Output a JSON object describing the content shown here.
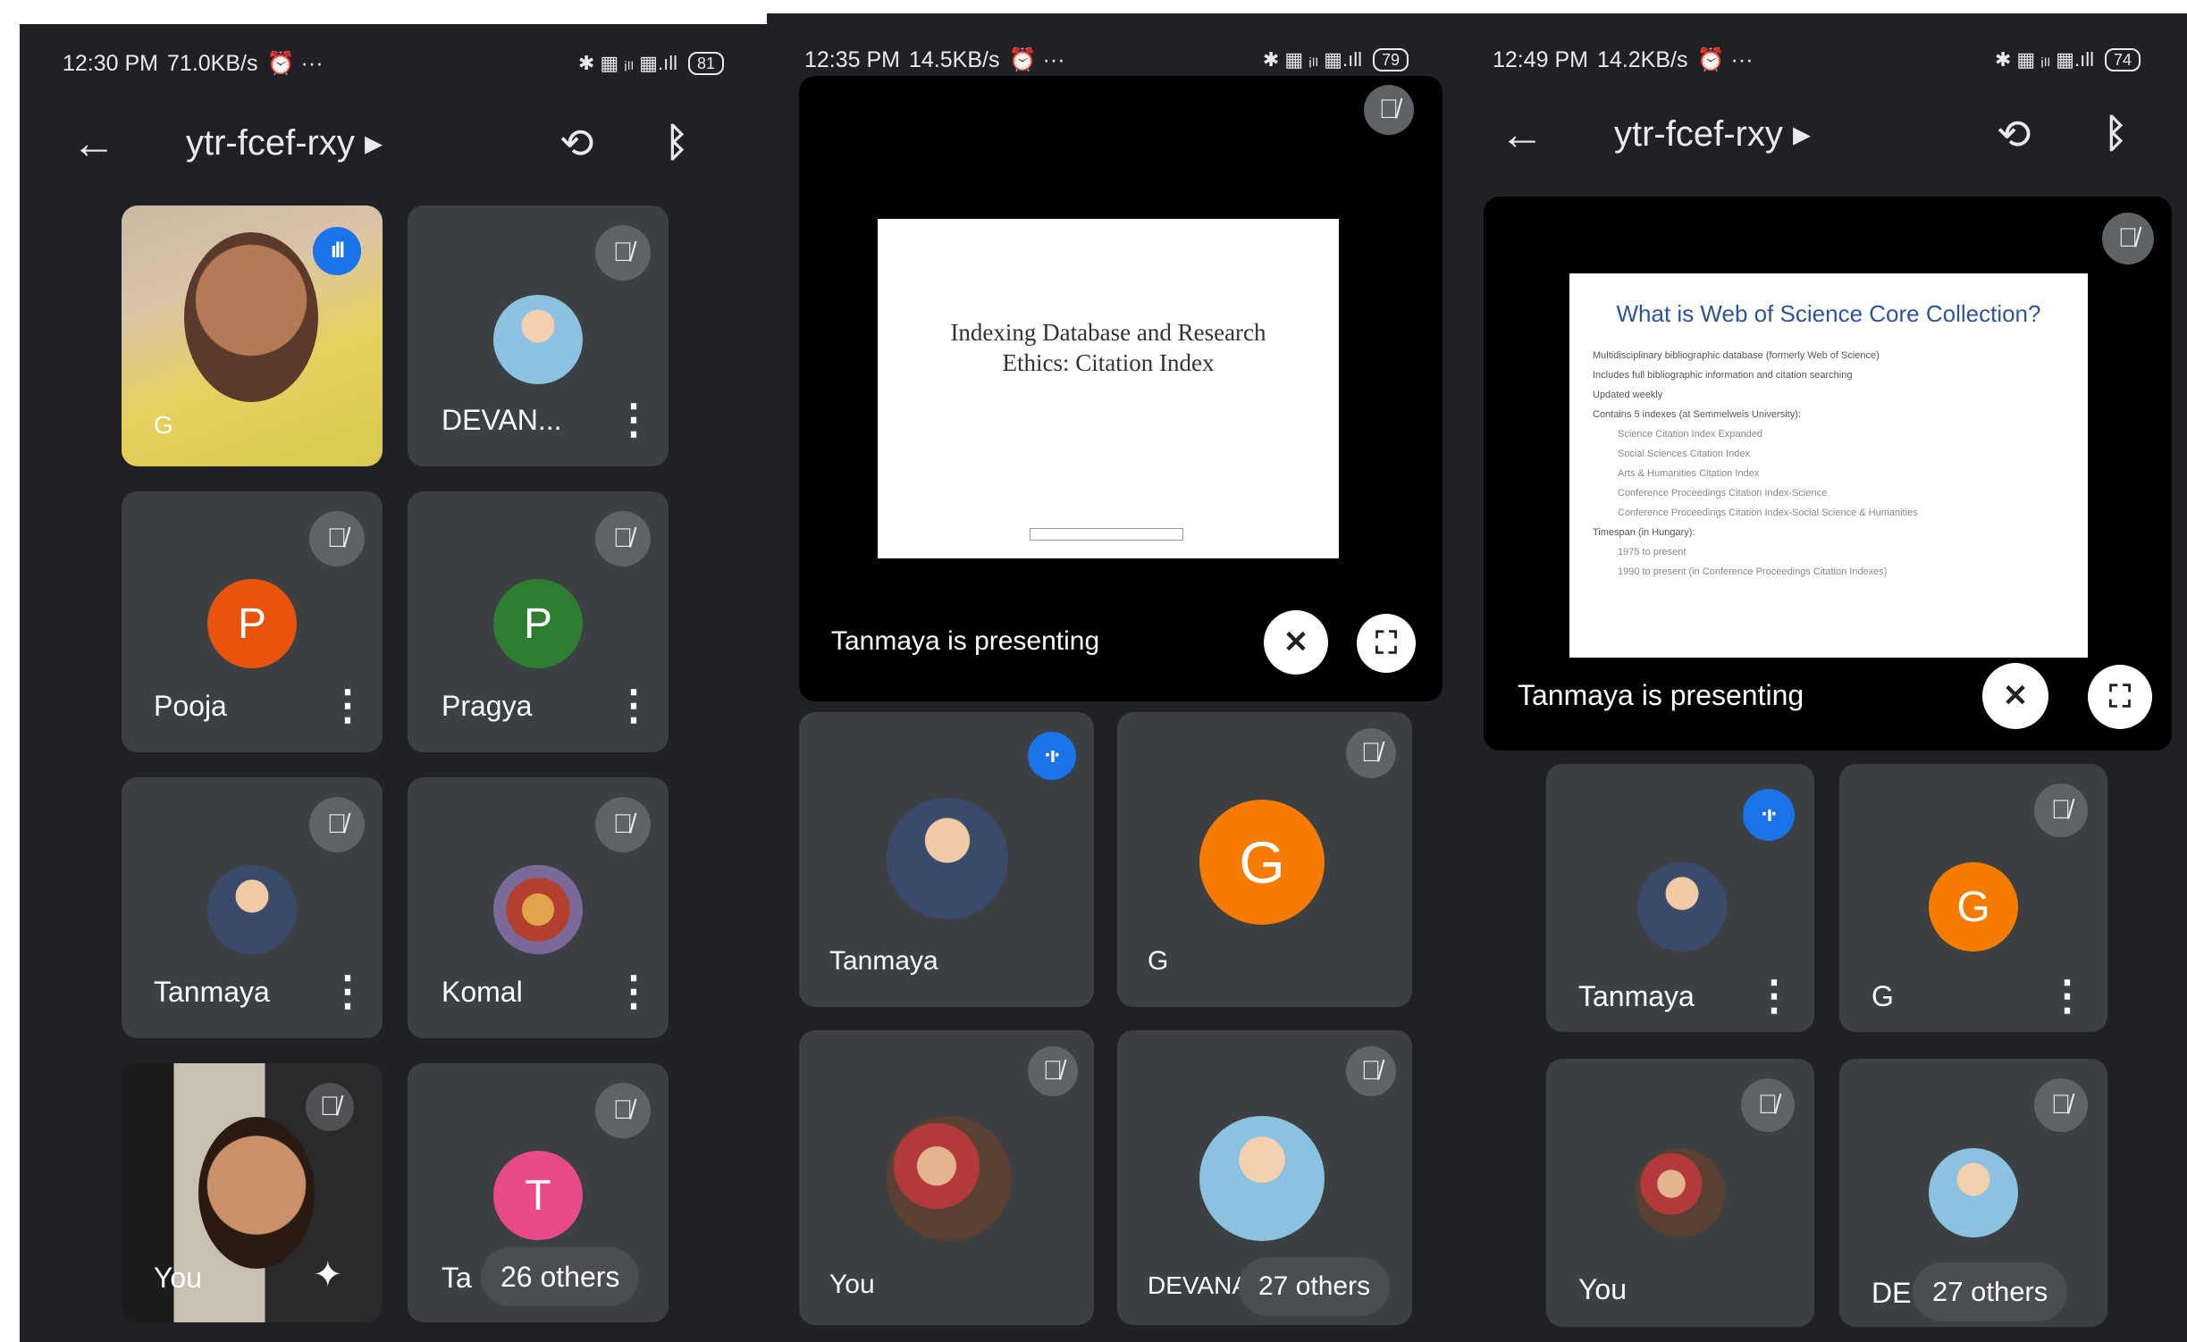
{
  "screens": [
    {
      "status": {
        "time": "12:30 PM",
        "speed": "71.0KB/s",
        "extra": "⏰ ···",
        "icons": "✱ ▦ ᵢₗₗ ▦.ıll",
        "battery": "81"
      },
      "meeting_code": "ytr-fcef-rxy",
      "tiles": [
        {
          "name": "G"
        },
        {
          "name": "DEVAN..."
        },
        {
          "name": "Pooja",
          "initial": "P",
          "color": "#e8530e"
        },
        {
          "name": "Pragya",
          "initial": "P",
          "color": "#2e7d32"
        },
        {
          "name": "Tanmaya"
        },
        {
          "name": "Komal"
        },
        {
          "name": "You"
        },
        {
          "name": "Ta",
          "initial": "T",
          "color": "#e84a8a"
        }
      ],
      "others": "26 others"
    },
    {
      "status": {
        "time": "12:35 PM",
        "speed": "14.5KB/s",
        "extra": "⏰ ···",
        "icons": "✱ ▦ ᵢₗₗ ▦.ıll",
        "battery": "79"
      },
      "slide_title": "Indexing Database and Research Ethics: Citation Index",
      "presenting": "Tanmaya is presenting",
      "tiles": [
        {
          "name": "Tanmaya"
        },
        {
          "name": "G",
          "initial": "G",
          "color": "#f57c00"
        },
        {
          "name": "You"
        },
        {
          "name": "DEVANA"
        }
      ],
      "others": "27 others"
    },
    {
      "status": {
        "time": "12:49 PM",
        "speed": "14.2KB/s",
        "extra": "⏰ ···",
        "icons": "✱ ▦ ᵢₗₗ ▦.ıll",
        "battery": "74"
      },
      "meeting_code": "ytr-fcef-rxy",
      "slide_title": "What is Web of Science Core Collection?",
      "slide_bullets": [
        "Multidisciplinary bibliographic database (formerly Web of Science)",
        "Includes full bibliographic information and citation searching",
        "Updated weekly",
        "Contains 5 indexes (at Semmelweis University):",
        "Science Citation Index Expanded",
        "Social Sciences Citation Index",
        "Arts & Humanities Citation Index",
        "Conference Proceedings Citation Index-Science",
        "Conference Proceedings Citation Index-Social Science & Humanities",
        "Timespan (in Hungary):",
        "1975 to present",
        "1990 to present (in Conference Proceedings Citation Indexes)"
      ],
      "presenting": "Tanmaya is presenting",
      "tiles": [
        {
          "name": "Tanmaya"
        },
        {
          "name": "G",
          "initial": "G",
          "color": "#f57c00"
        },
        {
          "name": "You"
        },
        {
          "name": "DE"
        }
      ],
      "others": "27 others"
    }
  ]
}
